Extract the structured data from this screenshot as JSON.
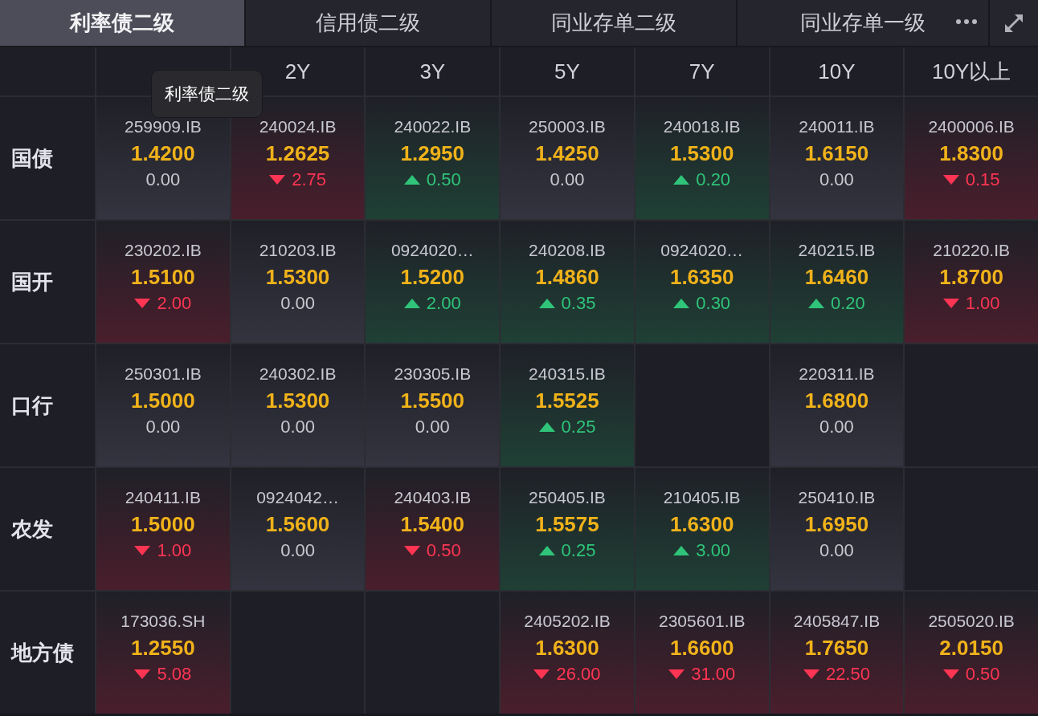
{
  "tabs": [
    {
      "label": "利率债二级",
      "selected": true
    },
    {
      "label": "信用债二级",
      "selected": false
    },
    {
      "label": "同业存单二级",
      "selected": false
    },
    {
      "label": "同业存单一级",
      "selected": false
    }
  ],
  "columns": [
    "2Y",
    "3Y",
    "5Y",
    "7Y",
    "10Y",
    "10Y以上"
  ],
  "tooltip": {
    "text": "利率债二级"
  },
  "rows": [
    {
      "label": "国债",
      "cells": [
        {
          "code": "259909.IB",
          "yield": "1.4200",
          "change": "0.00",
          "kind": "flat"
        },
        {
          "code": "240024.IB",
          "yield": "1.2625",
          "change": "2.75",
          "kind": "down"
        },
        {
          "code": "240022.IB",
          "yield": "1.2950",
          "change": "0.50",
          "kind": "up"
        },
        {
          "code": "250003.IB",
          "yield": "1.4250",
          "change": "0.00",
          "kind": "flat"
        },
        {
          "code": "240018.IB",
          "yield": "1.5300",
          "change": "0.20",
          "kind": "up"
        },
        {
          "code": "240011.IB",
          "yield": "1.6150",
          "change": "0.00",
          "kind": "flat"
        },
        {
          "code": "2400006.IB",
          "yield": "1.8300",
          "change": "0.15",
          "kind": "down"
        }
      ]
    },
    {
      "label": "国开",
      "cells": [
        {
          "code": "230202.IB",
          "yield": "1.5100",
          "change": "2.00",
          "kind": "down"
        },
        {
          "code": "210203.IB",
          "yield": "1.5300",
          "change": "0.00",
          "kind": "flat"
        },
        {
          "code": "0924020…",
          "yield": "1.5200",
          "change": "2.00",
          "kind": "up"
        },
        {
          "code": "240208.IB",
          "yield": "1.4860",
          "change": "0.35",
          "kind": "up"
        },
        {
          "code": "0924020…",
          "yield": "1.6350",
          "change": "0.30",
          "kind": "up"
        },
        {
          "code": "240215.IB",
          "yield": "1.6460",
          "change": "0.20",
          "kind": "up"
        },
        {
          "code": "210220.IB",
          "yield": "1.8700",
          "change": "1.00",
          "kind": "down"
        }
      ]
    },
    {
      "label": "口行",
      "cells": [
        {
          "code": "250301.IB",
          "yield": "1.5000",
          "change": "0.00",
          "kind": "flat"
        },
        {
          "code": "240302.IB",
          "yield": "1.5300",
          "change": "0.00",
          "kind": "flat"
        },
        {
          "code": "230305.IB",
          "yield": "1.5500",
          "change": "0.00",
          "kind": "flat"
        },
        {
          "code": "240315.IB",
          "yield": "1.5525",
          "change": "0.25",
          "kind": "up"
        },
        null,
        {
          "code": "220311.IB",
          "yield": "1.6800",
          "change": "0.00",
          "kind": "flat"
        },
        null
      ]
    },
    {
      "label": "农发",
      "cells": [
        {
          "code": "240411.IB",
          "yield": "1.5000",
          "change": "1.00",
          "kind": "down"
        },
        {
          "code": "0924042…",
          "yield": "1.5600",
          "change": "0.00",
          "kind": "flat"
        },
        {
          "code": "240403.IB",
          "yield": "1.5400",
          "change": "0.50",
          "kind": "down"
        },
        {
          "code": "250405.IB",
          "yield": "1.5575",
          "change": "0.25",
          "kind": "up"
        },
        {
          "code": "210405.IB",
          "yield": "1.6300",
          "change": "3.00",
          "kind": "up"
        },
        {
          "code": "250410.IB",
          "yield": "1.6950",
          "change": "0.00",
          "kind": "flat"
        },
        null
      ]
    },
    {
      "label": "地方债",
      "cells": [
        {
          "code": "173036.SH",
          "yield": "1.2550",
          "change": "5.08",
          "kind": "down"
        },
        null,
        null,
        {
          "code": "2405202.IB",
          "yield": "1.6300",
          "change": "26.00",
          "kind": "down"
        },
        {
          "code": "2305601.IB",
          "yield": "1.6600",
          "change": "31.00",
          "kind": "down"
        },
        {
          "code": "2405847.IB",
          "yield": "1.7650",
          "change": "22.50",
          "kind": "down"
        },
        {
          "code": "2505020.IB",
          "yield": "2.0150",
          "change": "0.50",
          "kind": "down"
        }
      ]
    }
  ]
}
